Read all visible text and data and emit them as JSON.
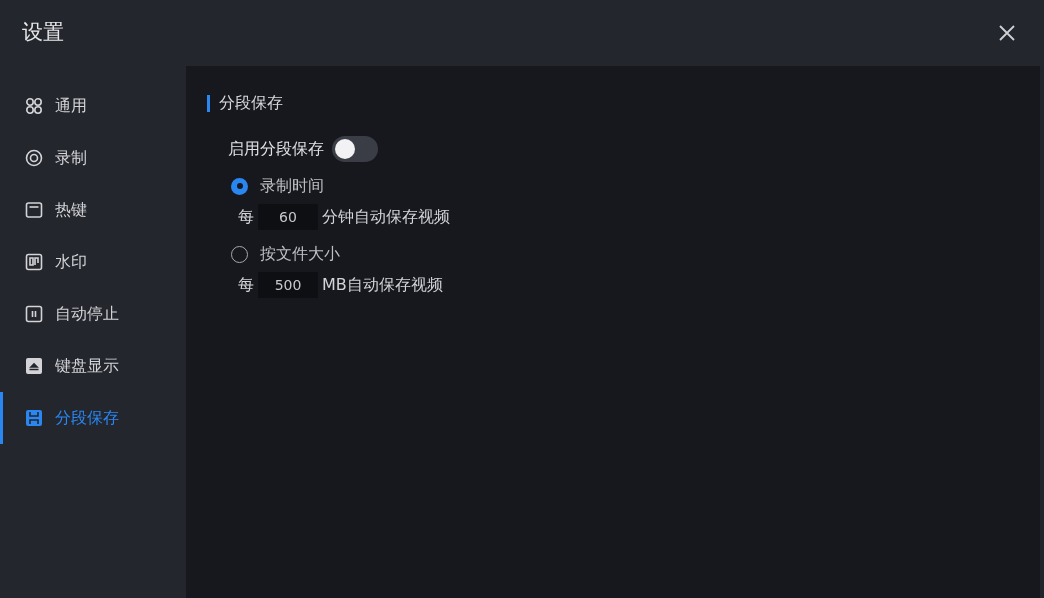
{
  "window": {
    "title": "设置"
  },
  "sidebar": {
    "items": [
      {
        "label": "通用",
        "selected": false
      },
      {
        "label": "录制",
        "selected": false
      },
      {
        "label": "热键",
        "selected": false
      },
      {
        "label": "水印",
        "selected": false
      },
      {
        "label": "自动停止",
        "selected": false
      },
      {
        "label": "键盘显示",
        "selected": false
      },
      {
        "label": "分段保存",
        "selected": true
      }
    ]
  },
  "section": {
    "title": "分段保存",
    "toggle": {
      "label": "启用分段保存",
      "on": false
    },
    "options": [
      {
        "label": "录制时间",
        "selected": true,
        "prefix": "每",
        "value": "60",
        "suffix": "分钟自动保存视频"
      },
      {
        "label": "按文件大小",
        "selected": false,
        "prefix": "每",
        "value": "500",
        "suffix": "MB自动保存视频"
      }
    ]
  }
}
